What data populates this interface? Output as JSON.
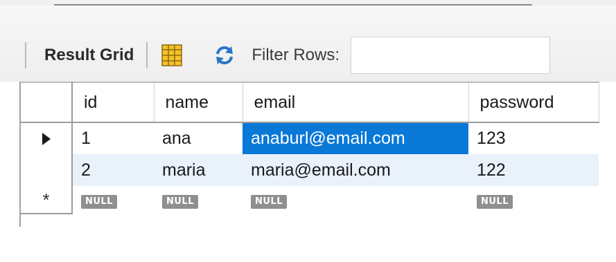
{
  "toolbar": {
    "result_grid_label": "Result Grid",
    "filter_rows_label": "Filter Rows:",
    "filter_value": "",
    "grid_icon": "form-grid-icon",
    "refresh_icon": "refresh-icon"
  },
  "grid": {
    "columns": [
      "id",
      "name",
      "email",
      "password"
    ],
    "rows": [
      {
        "id": "1",
        "name": "ana",
        "email": "anaburl@email.com",
        "password": "123",
        "current": true,
        "selected_cell": "email"
      },
      {
        "id": "2",
        "name": "maria",
        "email": "maria@email.com",
        "password": "122",
        "current": false
      }
    ],
    "new_row": {
      "id": "NULL",
      "name": "NULL",
      "email": "NULL",
      "password": "NULL"
    },
    "new_row_marker": "*"
  },
  "colors": {
    "selection": "#0a78d7",
    "alt_row": "#e9f1fb",
    "null_badge": "#8f8f8f",
    "refresh_blue": "#2b74c9"
  }
}
